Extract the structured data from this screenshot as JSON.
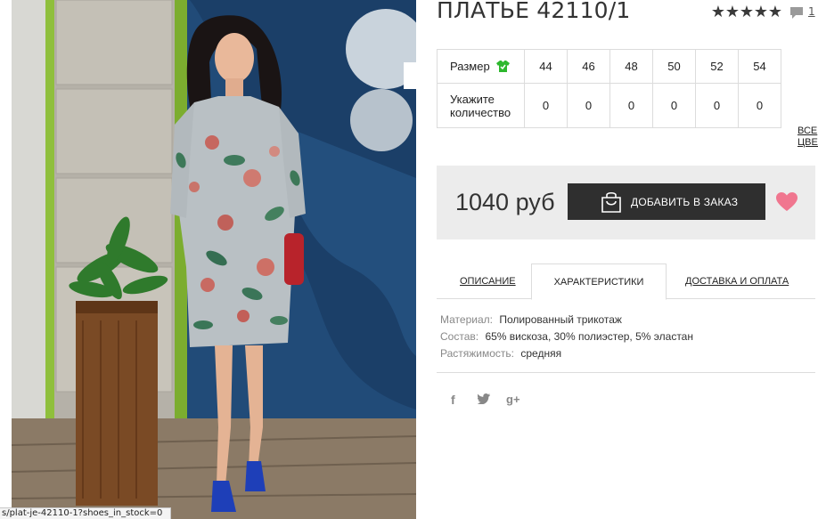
{
  "product": {
    "title": "ПЛАТЬЕ 42110/1",
    "rating_stars": 5,
    "reviews_count": "1"
  },
  "sizes": {
    "size_label": "Размер",
    "qty_label_line1": "Укажите",
    "qty_label_line2": "количество",
    "values": [
      "44",
      "46",
      "48",
      "50",
      "52",
      "54"
    ],
    "quantities": [
      "0",
      "0",
      "0",
      "0",
      "0",
      "0"
    ]
  },
  "all_colors": {
    "line1": "ВСЕ",
    "line2": "ЦВЕТ"
  },
  "price": {
    "value": "1040 руб",
    "add_button_label": "ДОБАВИТЬ В ЗАКАЗ"
  },
  "tabs": {
    "description": "ОПИСАНИЕ",
    "characteristics": "ХАРАКТЕРИСТИКИ",
    "delivery": "ДОСТАВКА И ОПЛАТА",
    "active": "characteristics"
  },
  "specs": [
    {
      "key": "Материал:",
      "value": "Полированный трикотаж"
    },
    {
      "key": "Состав:",
      "value": "65% вискоза, 30% полиэстер, 5% эластан"
    },
    {
      "key": "Растяжимость:",
      "value": "средняя"
    }
  ],
  "social": {
    "facebook": "f",
    "twitter": "🐦",
    "googleplus": "g+"
  },
  "status_url": "s/plat-je-42110-1?shoes_in_stock=0",
  "colors": {
    "accent_green": "#2eb82e",
    "heart_pink": "#f0768f",
    "button_dark": "#2f2f2f"
  }
}
